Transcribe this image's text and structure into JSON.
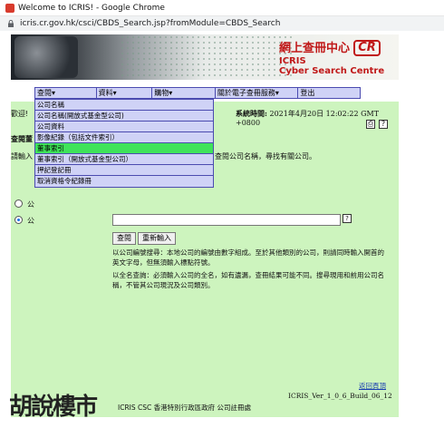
{
  "browser": {
    "window_title": "Welcome to ICRIS! - Google Chrome",
    "url": "icris.cr.gov.hk/csci/CBDS_Search.jsp?fromModule=CBDS_Search"
  },
  "banner": {
    "cn_title": "網上查冊中心",
    "logo_text": "CR",
    "brand_line1": "ICRIS",
    "brand_line2": "Cyber Search Centre"
  },
  "menu": {
    "items": [
      {
        "label": "查閱▾"
      },
      {
        "label": "資料▾"
      },
      {
        "label": "購物▾"
      },
      {
        "label": "關於電子查冊服務▾"
      },
      {
        "label": "登出"
      }
    ]
  },
  "dropdown": {
    "items": [
      {
        "label": "公司名稱",
        "active": false
      },
      {
        "label": "公司名稱(開放式基金型公司)",
        "active": false
      },
      {
        "label": "公司資料",
        "active": false
      },
      {
        "label": "影像紀錄（包括文件索引）",
        "active": false
      },
      {
        "label": "董事索引",
        "active": true
      },
      {
        "label": "董事索引（開放式基金型公司）",
        "active": false
      },
      {
        "label": "押記登記冊",
        "active": false
      },
      {
        "label": "取消資格令紀錄冊",
        "active": false
      }
    ]
  },
  "content": {
    "welcome": "歡迎!",
    "systime_label": "系統時間:",
    "systime_value": "2021年4月20日 12:02:22 GMT +0800",
    "section_title": "查閱董",
    "hint_left": "請輸入",
    "hint_right": "查閱公司名稱，尋找有關公司。",
    "radio_1_label": "公",
    "radio_2_label": "公",
    "search_value": "",
    "search_button": "查閱",
    "reset_button": "重新輸入",
    "note_1": "以公司編號搜尋：本地公司的編號由數字組成。至於其他類別的公司，則請同時輸入開首的英文字母，但無須輸入標點符號。",
    "note_2": "以全名查詢：必須輸入公司的全名，如有遺漏，查冊結果可能不同。搜尋現用和前用公司名稱，不管其公司現況及公司類別。",
    "back_to_top": "返回頁頂",
    "version": "ICRIS_Ver_1_0_6_Build_06_12",
    "footer": "ICRIS CSC 香港特別行政區政府 公司註冊處"
  },
  "watermark": {
    "text": "胡說樓市"
  }
}
